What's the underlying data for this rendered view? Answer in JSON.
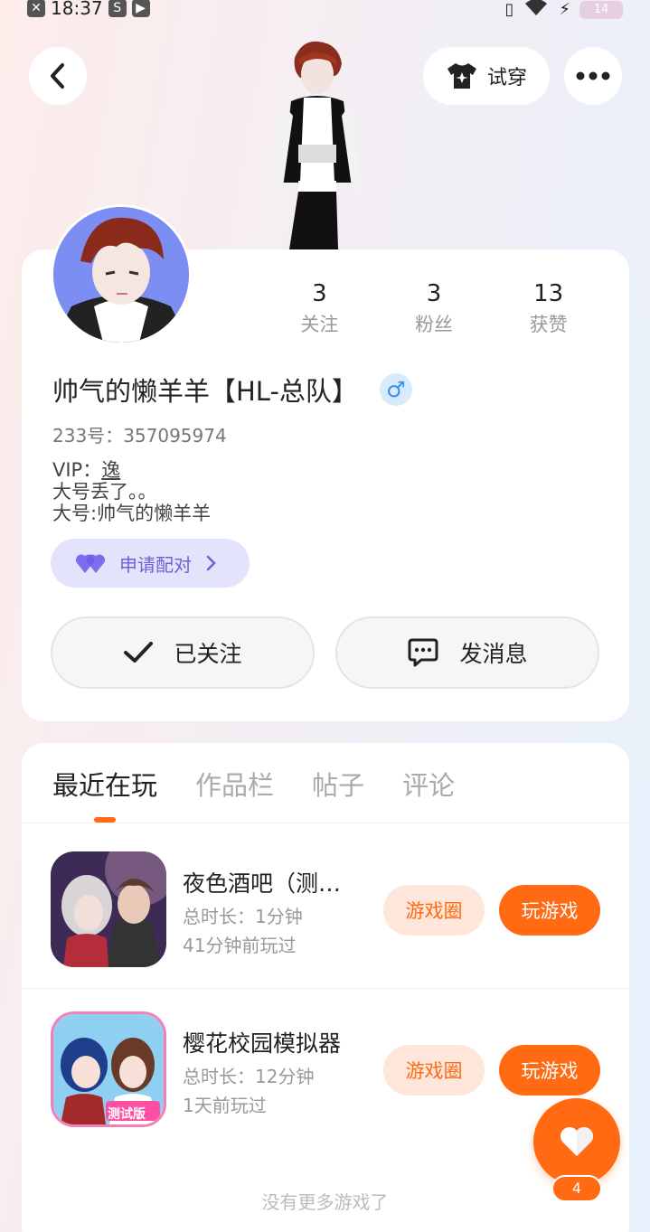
{
  "status_bar": {
    "time": "18:37",
    "battery": "14"
  },
  "header": {
    "try_on_label": "试穿"
  },
  "profile": {
    "stats": [
      {
        "value": "3",
        "label": "关注"
      },
      {
        "value": "3",
        "label": "粉丝"
      },
      {
        "value": "13",
        "label": "获赞"
      }
    ],
    "username": "帅气的懒羊羊【HL-总队】",
    "gender_symbol": "♂",
    "id_label": "233号：",
    "id_value": "357095974",
    "bio_vip_label": "VIP：",
    "bio_vip_value": "逸",
    "bio_line2": "大号丢了。。",
    "bio_line3": "大号:帅气的懒羊羊",
    "pair_label": "申请配对",
    "follow_label": "已关注",
    "message_label": "发消息"
  },
  "tabs": [
    {
      "label": "最近在玩",
      "active": true
    },
    {
      "label": "作品栏",
      "active": false
    },
    {
      "label": "帖子",
      "active": false
    },
    {
      "label": "评论",
      "active": false
    }
  ],
  "games": [
    {
      "title": "夜色酒吧（测试版）",
      "duration": "总时长：1分钟",
      "last_played": "41分钟前玩过",
      "circle_label": "游戏圈",
      "play_label": "玩游戏",
      "icon": "night-bar-icon"
    },
    {
      "title": "樱花校园模拟器",
      "duration": "总时长：12分钟",
      "last_played": "1天前玩过",
      "circle_label": "游戏圈",
      "play_label": "玩游戏",
      "icon": "sakura-school-icon",
      "icon_badge": "测试版"
    }
  ],
  "footer": {
    "no_more": "没有更多游戏了"
  },
  "like_fab": {
    "count": "4"
  },
  "colors": {
    "accent": "#ff6a13",
    "accent_light": "#ffe6db",
    "pair_bg": "#e4e3fc",
    "pair_text": "#6a63d8"
  }
}
